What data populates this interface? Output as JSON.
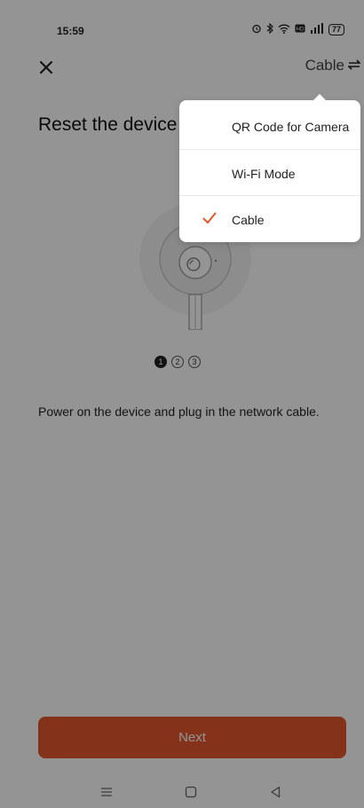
{
  "status_bar": {
    "time": "15:59",
    "icons": [
      "alarm-icon",
      "bluetooth-icon",
      "wifi-icon",
      "hd-icon",
      "signal-icon"
    ],
    "battery": "77"
  },
  "header": {
    "close_icon": "close-icon",
    "mode_label": "Cable",
    "mode_icon": "swap-arrows-icon"
  },
  "page": {
    "title": "Reset the device",
    "steps": [
      "1",
      "2",
      "3"
    ],
    "active_step": 1,
    "instruction": "Power on the device and plug in the network cable.",
    "next_label": "Next"
  },
  "menu": {
    "items": [
      {
        "label": "QR Code for Camera",
        "selected": false
      },
      {
        "label": "Wi-Fi Mode",
        "selected": false
      },
      {
        "label": "Cable",
        "selected": true
      }
    ]
  },
  "nav_bar": {
    "icons": [
      "menu-icon",
      "home-icon",
      "back-icon"
    ]
  },
  "colors": {
    "accent": "#e3562b",
    "check": "#e3562b"
  }
}
